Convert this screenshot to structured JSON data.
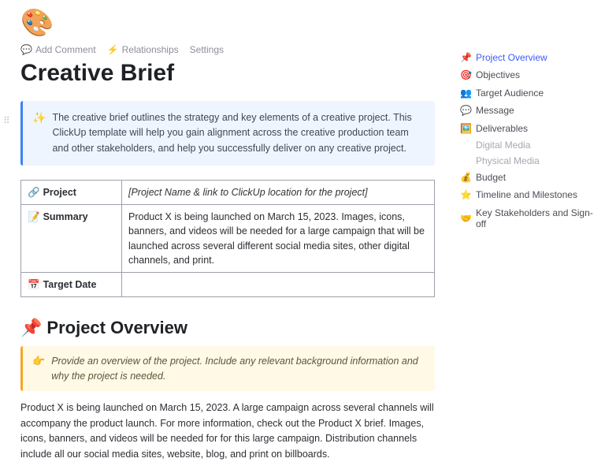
{
  "header": {
    "palette_emoji": "🎨",
    "toolbar": {
      "add_comment": "Add Comment",
      "relationships": "Relationships",
      "settings": "Settings"
    },
    "title": "Creative Brief"
  },
  "intro_callout": {
    "icon": "✨",
    "text": "The creative brief outlines the strategy and key elements of a creative project. This ClickUp template will help you gain alignment across the creative production team and other stakeholders, and help you successfully deliver on any creative project."
  },
  "info_table": {
    "rows": [
      {
        "icon": "🔗",
        "label": "Project",
        "value": "[Project Name & link to ClickUp location for the project]",
        "italic": true
      },
      {
        "icon": "📝",
        "label": "Summary",
        "value": "Product X is being launched on March 15, 2023. Images, icons, banners, and videos will be needed for a large campaign that will be launched across several different social media sites, other digital channels, and print."
      },
      {
        "icon": "📅",
        "label": "Target Date",
        "value": ""
      }
    ]
  },
  "overview": {
    "heading_icon": "📌",
    "heading": "Project Overview",
    "tip_icon": "👉",
    "tip": "Provide an overview of the project. Include any relevant background information and why the project is needed.",
    "body": "Product X is being launched on March 15, 2023. A large campaign across several channels will accompany the product launch. For more information, check out the Product X brief. Images, icons, banners, and videos will be needed for for this large campaign. Distribution channels include all our social media sites, website, blog, and print on billboards."
  },
  "toc": [
    {
      "icon": "📌",
      "label": "Project Overview",
      "active": true
    },
    {
      "icon": "🎯",
      "label": "Objectives"
    },
    {
      "icon": "👥",
      "label": "Target Audience"
    },
    {
      "icon": "💬",
      "label": "Message"
    },
    {
      "icon": "🖼️",
      "label": "Deliverables",
      "subs": [
        "Digital Media",
        "Physical Media"
      ]
    },
    {
      "icon": "💰",
      "label": "Budget"
    },
    {
      "icon": "⭐",
      "label": "Timeline and Milestones"
    },
    {
      "icon": "🤝",
      "label": "Key Stakeholders and Sign-off"
    }
  ]
}
